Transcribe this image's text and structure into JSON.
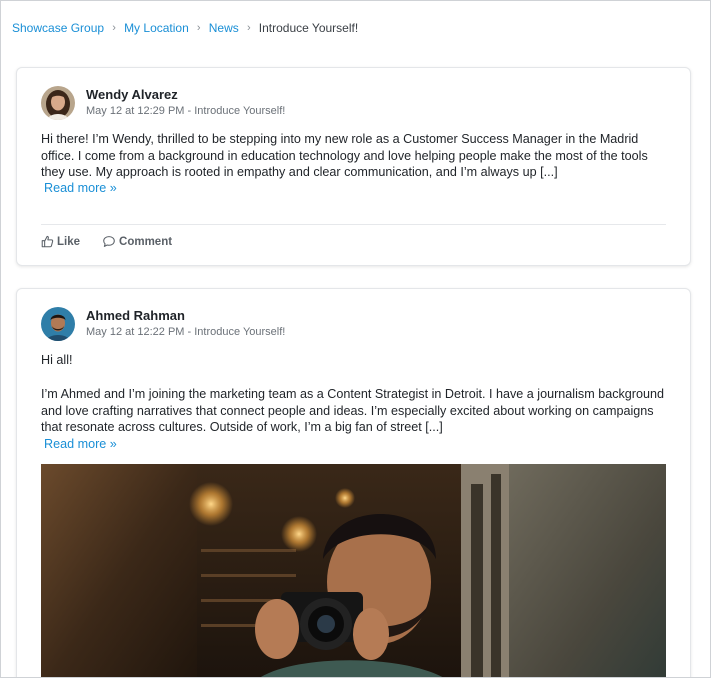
{
  "breadcrumb": {
    "items": [
      "Showcase Group",
      "My Location",
      "News"
    ],
    "current": "Introduce Yourself!",
    "separator": "›"
  },
  "posts": [
    {
      "author": "Wendy Alvarez",
      "meta": "May 12 at 12:29 PM - Introduce Yourself!",
      "paragraphs": [
        "Hi there! I’m Wendy, thrilled to be stepping into my new role as a Customer Success Manager in the Madrid office. I come from a background in education technology and love helping people make the most of the tools they use. My approach is rooted in empathy and clear communication, and I’m always up [...]"
      ],
      "read_more": "Read more »",
      "like_label": "Like",
      "comment_label": "Comment"
    },
    {
      "author": "Ahmed Rahman",
      "meta": "May 12 at 12:22 PM - Introduce Yourself!",
      "paragraphs": [
        "Hi all!",
        "I’m Ahmed and I’m joining the marketing team as a Content Strategist in Detroit. I have a journalism background and love crafting narratives that connect people and ideas. I’m especially excited about working on campaigns that resonate across cultures. Outside of work, I’m a big fan of street [...]"
      ],
      "read_more": "Read more »"
    }
  ],
  "colors": {
    "link": "#1a8fd6",
    "text": "#1f2328",
    "muted": "#6b7178"
  }
}
